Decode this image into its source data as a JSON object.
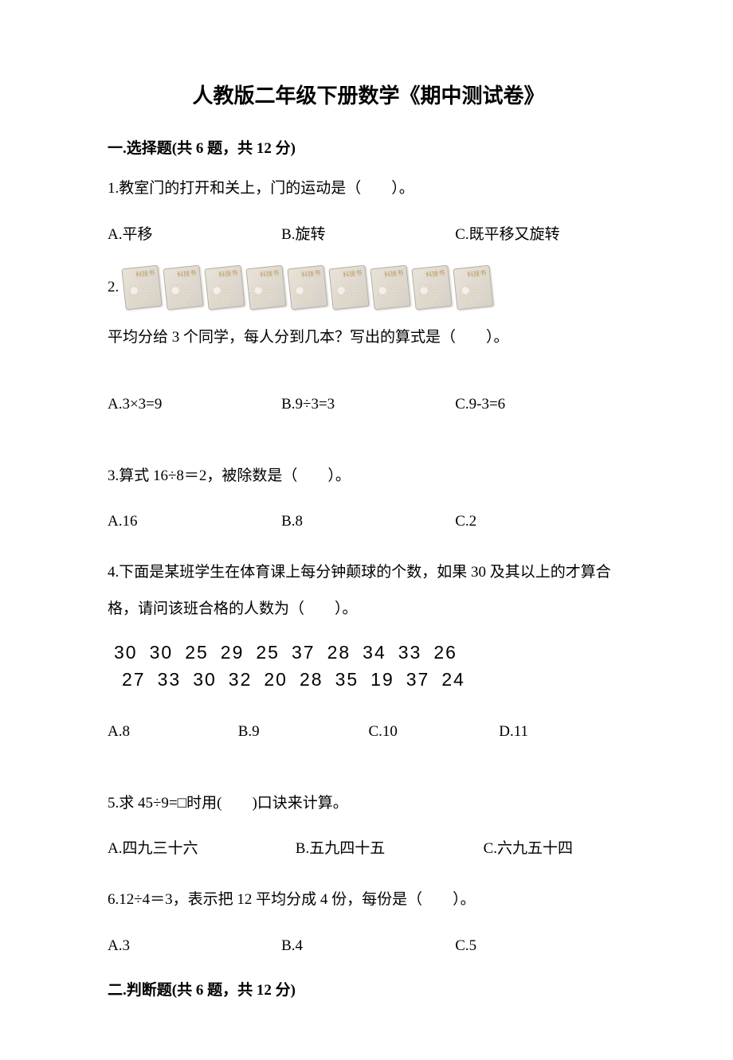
{
  "title": "人教版二年级下册数学《期中测试卷》",
  "section1": {
    "heading": "一.选择题(共 6 题，共 12 分)"
  },
  "q1": {
    "text": "1.教室门的打开和关上，门的运动是（　　）。",
    "a": "A.平移",
    "b": "B.旋转",
    "c": "C.既平移又旋转"
  },
  "q2": {
    "prefix": "2.",
    "book_label": "科技书",
    "text": "平均分给 3 个同学，每人分到几本？写出的算式是（　　）。",
    "a": "A.3×3=9",
    "b": "B.9÷3=3",
    "c": "C.9-3=6"
  },
  "q3": {
    "text": "3.算式 16÷8＝2，被除数是（　　）。",
    "a": "A.16",
    "b": "B.8",
    "c": "C.2"
  },
  "q4": {
    "text": "4.下面是某班学生在体育课上每分钟颠球的个数，如果 30 及其以上的才算合格，请问该班合格的人数为（　　）。",
    "row1": [
      "30",
      "30",
      "25",
      "29",
      "25",
      "37",
      "28",
      "34",
      "33",
      "26"
    ],
    "row2": [
      "27",
      "33",
      "30",
      "32",
      "20",
      "28",
      "35",
      "19",
      "37",
      "24"
    ],
    "a": "A.8",
    "b": "B.9",
    "c": "C.10",
    "d": "D.11"
  },
  "q5": {
    "text": "5.求 45÷9=□时用(　　)口诀来计算。",
    "a": "A.四九三十六",
    "b": "B.五九四十五",
    "c": "C.六九五十四"
  },
  "q6": {
    "text": "6.12÷4＝3，表示把 12 平均分成 4 份，每份是（　　）。",
    "a": "A.3",
    "b": "B.4",
    "c": "C.5"
  },
  "section2": {
    "heading": "二.判断题(共 6 题，共 12 分)"
  }
}
